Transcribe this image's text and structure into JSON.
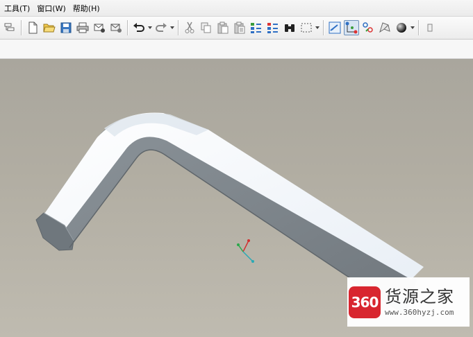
{
  "menu": {
    "items": [
      {
        "label": "工具(T)"
      },
      {
        "label": "窗口(W)"
      },
      {
        "label": "帮助(H)"
      }
    ]
  },
  "toolbar": {
    "buttons": [
      {
        "icon": "regenerate-icon"
      },
      {
        "icon": "new-file-icon"
      },
      {
        "icon": "open-folder-icon"
      },
      {
        "icon": "save-icon"
      },
      {
        "icon": "print-icon"
      },
      {
        "icon": "send-mail-icon"
      },
      {
        "icon": "mail-close-icon"
      },
      {
        "icon": "undo-icon"
      },
      {
        "icon": "redo-icon"
      },
      {
        "icon": "cut-icon"
      },
      {
        "icon": "copy-icon"
      },
      {
        "icon": "paste-icon"
      },
      {
        "icon": "paste-special-icon"
      },
      {
        "icon": "regenerate-model-icon"
      },
      {
        "icon": "regenerate-manager-icon"
      },
      {
        "icon": "find-binoculars-icon"
      },
      {
        "icon": "select-box-icon"
      },
      {
        "icon": "datum-plane-icon"
      },
      {
        "icon": "datum-axis-icon"
      },
      {
        "icon": "datum-point-icon"
      },
      {
        "icon": "coordinate-system-icon"
      },
      {
        "icon": "shading-sphere-icon"
      }
    ]
  },
  "watermark": {
    "logo_text": "360",
    "title": "货源之家",
    "url": "www.360hyzj.com"
  },
  "colors": {
    "part_top": "#f4f7fb",
    "part_side": "#7e868c",
    "background_top": "#a9a69d",
    "background_bottom": "#bfbbb0",
    "logo_red": "#d8262f"
  }
}
